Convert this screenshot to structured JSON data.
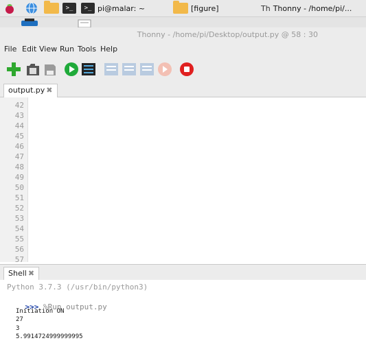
{
  "taskbar": {
    "terminal_task": "pi@malar: ~",
    "folder_task": "[figure]",
    "thonny_task": "Thonny  -  /home/pi/..."
  },
  "window": {
    "title": "Thonny  -  /home/pi/Desktop/output.py  @  58 : 30"
  },
  "menu": [
    "File",
    "Edit",
    "View",
    "Run",
    "Tools",
    "Help"
  ],
  "toolbar": {
    "icons": [
      "new-file-icon",
      "open-file-icon",
      "save-file-icon",
      "run-icon",
      "debug-icon",
      "step-over-icon",
      "step-into-icon",
      "step-out-icon",
      "resume-icon",
      "stop-icon"
    ]
  },
  "editor": {
    "tab_label": "output.py",
    "tab_close": "✖",
    "line_numbers": [
      "42",
      "43",
      "44",
      "45",
      "46",
      "47",
      "48",
      "49",
      "50",
      "51",
      "52",
      "53",
      "54",
      "55",
      "56",
      "57"
    ]
  },
  "shell": {
    "tab_label": "Shell",
    "tab_close": "✖",
    "version_line": "Python 3.7.3 (/usr/bin/python3)",
    "prompt": ">>>",
    "command": " %Run output.py",
    "output": [
      "Initiation ON",
      "27",
      "3",
      "5.9914724999999995"
    ]
  },
  "colors": {
    "string": "#1f8f1f",
    "number": "#c15c00",
    "builtin": "#7a32b0",
    "prompt": "#1a3fa8"
  }
}
